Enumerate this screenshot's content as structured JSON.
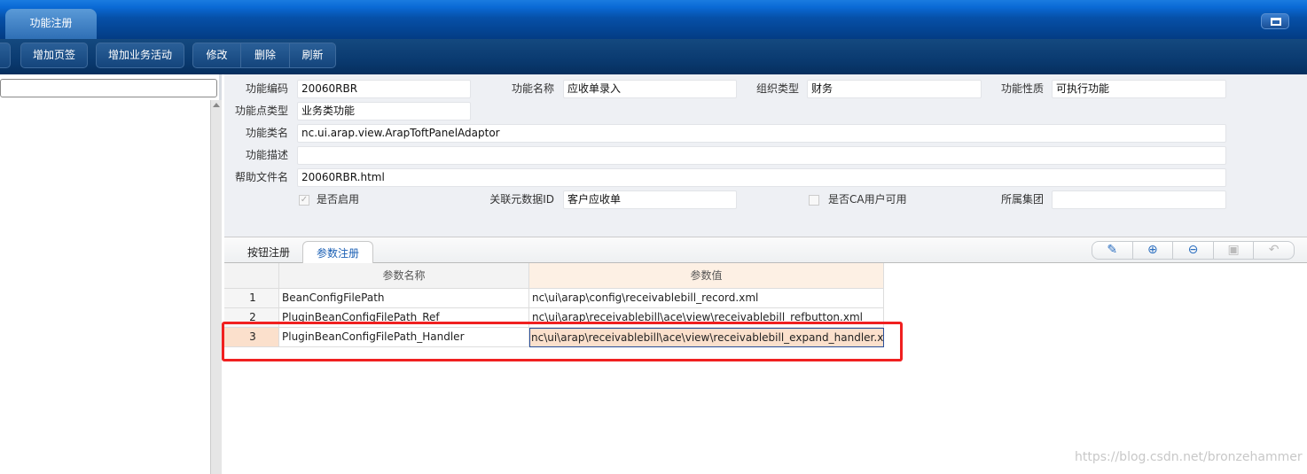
{
  "window": {
    "tab": "功能注册"
  },
  "toolbar": {
    "buttons": [
      "增加页签",
      "增加业务活动",
      "修改",
      "删除",
      "刷新"
    ]
  },
  "form": {
    "code_label": "功能编码",
    "code": "20060RBR",
    "name_label": "功能名称",
    "name": "应收单录入",
    "org_type_label": "组织类型",
    "org_type": "财务",
    "nature_label": "功能性质",
    "nature": "可执行功能",
    "point_type_label": "功能点类型",
    "point_type": "业务类功能",
    "class_label": "功能类名",
    "class": "nc.ui.arap.view.ArapToftPanelAdaptor",
    "desc_label": "功能描述",
    "desc": "",
    "help_label": "帮助文件名",
    "help": "20060RBR.html",
    "enabled_label": "是否启用",
    "enabled": true,
    "meta_label": "关联元数据ID",
    "meta": "客户应收单",
    "ca_label": "是否CA用户可用",
    "ca": false,
    "group_label": "所属集团",
    "group": ""
  },
  "subtabs": [
    "按钮注册",
    "参数注册"
  ],
  "active_subtab": "参数注册",
  "grid": {
    "headers": [
      "参数名称",
      "参数值"
    ],
    "rows": [
      {
        "no": "1",
        "name": "BeanConfigFilePath",
        "value": "nc\\ui\\arap\\config\\receivablebill_record.xml"
      },
      {
        "no": "2",
        "name": "PluginBeanConfigFilePath_Ref",
        "value": "nc\\ui\\arap\\receivablebill\\ace\\view\\receivablebill_refbutton.xml"
      },
      {
        "no": "3",
        "name": "PluginBeanConfigFilePath_Handler",
        "value": "nc\\ui\\arap\\receivablebill\\ace\\view\\receivablebill_expand_handler.xml"
      }
    ],
    "selected_row": 3
  },
  "icons": [
    "edit-icon",
    "add-row-icon",
    "delete-row-icon",
    "save-icon",
    "undo-icon"
  ],
  "watermark": "https://blog.csdn.net/bronzehammer",
  "colors": {
    "highlight": "#f02020",
    "selected_row": "#fbe0cc",
    "header_value": "#fdf0e4"
  }
}
